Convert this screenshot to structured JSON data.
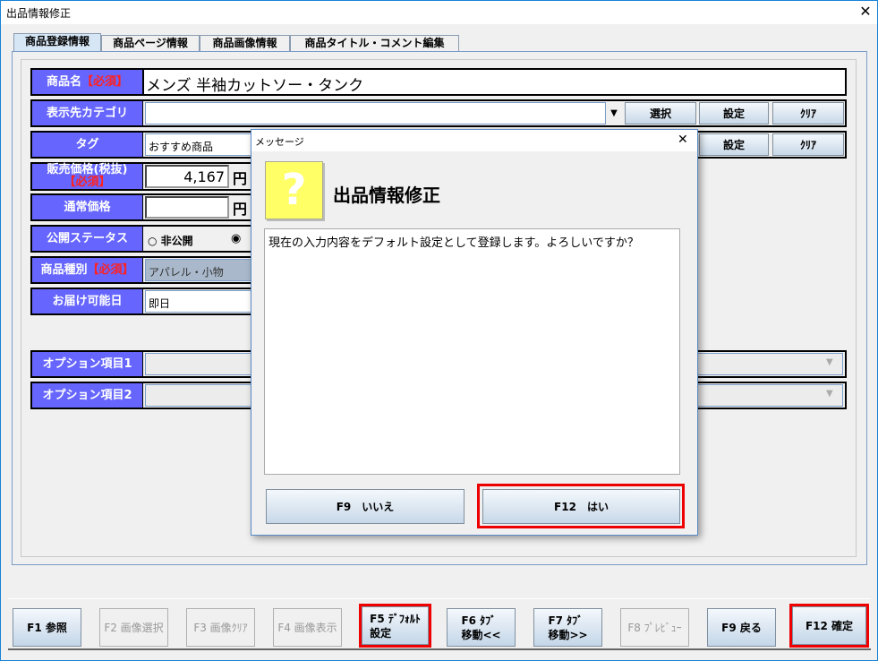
{
  "window": {
    "title": "出品情報修正",
    "close": "✕"
  },
  "tabs": [
    "商品登録情報",
    "商品ページ情報",
    "商品画像情報",
    "商品タイトル・コメント編集"
  ],
  "form": {
    "required_mark": "【必須】",
    "product_name": {
      "label": "商品名",
      "value": "メンズ 半袖カットソー・タンク"
    },
    "category": {
      "label": "表示先カテゴリ",
      "value": "",
      "select": "選択",
      "set": "設定",
      "clear": "ｸﾘｱ"
    },
    "tag": {
      "label": "タグ",
      "value": "おすすめ商品",
      "set": "設定",
      "clear": "ｸﾘｱ"
    },
    "price": {
      "label": "販売価格(税抜)",
      "value": "4,167",
      "unit": "円"
    },
    "regular_price": {
      "label": "通常価格",
      "value": "",
      "unit": "円"
    },
    "status": {
      "label": "公開ステータス",
      "options": [
        "非公開"
      ],
      "selected_index": 1
    },
    "type": {
      "label": "商品種別",
      "value": "アパレル・小物"
    },
    "delivery": {
      "label": "お届け可能日",
      "value": "即日"
    },
    "option1": {
      "label": "オプション項目1"
    },
    "option2": {
      "label": "オプション項目2"
    }
  },
  "dialog": {
    "title": "メッセージ",
    "close": "✕",
    "icon": "?",
    "heading": "出品情報修正",
    "message": "現在の入力内容をデフォルト設定として登録します。よろしいですか？",
    "no": "F9　いいえ",
    "yes": "F12　はい"
  },
  "fkeys": [
    {
      "label": "F1 参照",
      "enabled": true
    },
    {
      "label": "F2 画像選択",
      "enabled": false
    },
    {
      "label": "F3 画像ｸﾘｱ",
      "enabled": false
    },
    {
      "label": "F4 画像表示",
      "enabled": false
    },
    {
      "label": "F5 ﾃﾞﾌｫﾙﾄ\n設定",
      "enabled": true
    },
    {
      "label": "F6 ﾀﾌﾞ\n移動<<",
      "enabled": true
    },
    {
      "label": "F7 ﾀﾌﾞ\n移動>>",
      "enabled": true
    },
    {
      "label": "F8 ﾌﾟﾚﾋﾞｭｰ",
      "enabled": false
    },
    {
      "label": "F9 戻る",
      "enabled": true
    },
    {
      "label": "F12 確定",
      "enabled": true
    }
  ]
}
